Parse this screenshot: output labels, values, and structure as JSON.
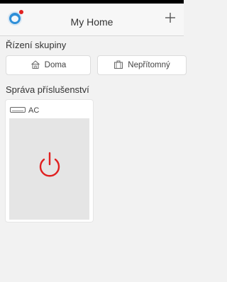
{
  "header": {
    "title": "My Home",
    "avatar_icon": "user-avatar-icon",
    "add_icon": "plus-icon"
  },
  "group_control": {
    "title": "Řízení skupiny",
    "buttons": [
      {
        "label": "Doma",
        "icon": "home-icon"
      },
      {
        "label": "Nepřítomný",
        "icon": "luggage-icon"
      }
    ]
  },
  "accessories": {
    "title": "Správa příslušenství",
    "cards": [
      {
        "label": "AC",
        "icon": "air-conditioner-icon",
        "power_icon": "power-icon",
        "power_color": "#e02020"
      }
    ]
  },
  "colors": {
    "accent_red": "#e02020",
    "avatar_blue": "#2f8fd8"
  }
}
